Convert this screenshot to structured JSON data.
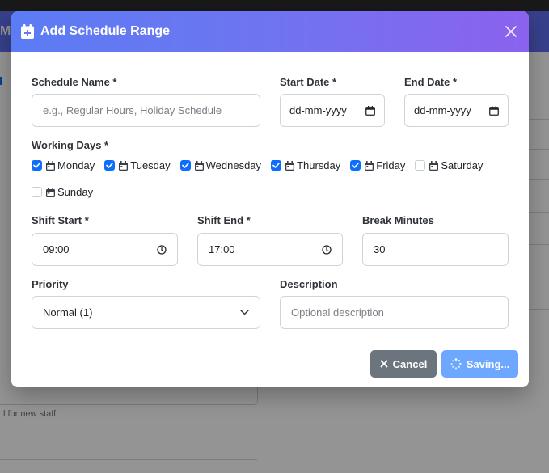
{
  "background": {
    "header_fragment": "M",
    "help_fragment": "l for new staff"
  },
  "modal": {
    "title": "Add Schedule Range",
    "icon": "calendar-plus-icon",
    "close_icon": "close-icon"
  },
  "form": {
    "schedule_name": {
      "label": "Schedule Name *",
      "placeholder": "e.g., Regular Hours, Holiday Schedule",
      "value": ""
    },
    "start_date": {
      "label": "Start Date *",
      "placeholder": "dd-mm-yyyy"
    },
    "end_date": {
      "label": "End Date *",
      "placeholder": "dd-mm-yyyy"
    },
    "working_days": {
      "label": "Working Days *",
      "days": [
        {
          "label": "Monday",
          "checked": true
        },
        {
          "label": "Tuesday",
          "checked": true
        },
        {
          "label": "Wednesday",
          "checked": true
        },
        {
          "label": "Thursday",
          "checked": true
        },
        {
          "label": "Friday",
          "checked": true
        },
        {
          "label": "Saturday",
          "checked": false
        },
        {
          "label": "Sunday",
          "checked": false
        }
      ]
    },
    "shift_start": {
      "label": "Shift Start *",
      "value": "09:00"
    },
    "shift_end": {
      "label": "Shift End *",
      "value": "17:00"
    },
    "break_minutes": {
      "label": "Break Minutes",
      "value": "30"
    },
    "priority": {
      "label": "Priority",
      "value": "Normal (1)"
    },
    "description": {
      "label": "Description",
      "placeholder": "Optional description"
    }
  },
  "footer": {
    "cancel_label": "Cancel",
    "save_label": "Saving..."
  },
  "colors": {
    "header_gradient_start": "#5b7cf5",
    "header_gradient_end": "#8b62ee",
    "checkbox_checked": "#0d6efd",
    "cancel_button": "#6c757d",
    "save_button": "#6ea8fe"
  }
}
